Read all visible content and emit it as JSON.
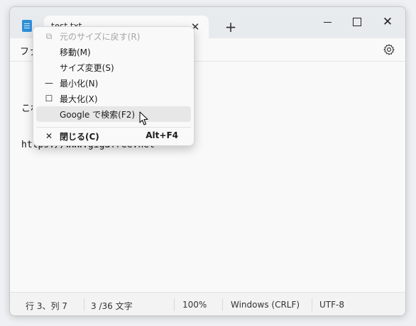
{
  "window": {
    "tab_title": "test.txt",
    "close_glyph": "✕",
    "new_tab_glyph": "+"
  },
  "menubar": {
    "file_label": "ファイル"
  },
  "editor": {
    "line1": "これは",
    "line2": "https://www.gigafree.net"
  },
  "context_menu": {
    "items": [
      {
        "icon": "restore-icon",
        "glyph": "⧉",
        "label": "元のサイズに戻す(R)",
        "shortcut": "",
        "disabled": true
      },
      {
        "icon": "",
        "glyph": "",
        "label": "移動(M)",
        "shortcut": "",
        "disabled": false
      },
      {
        "icon": "",
        "glyph": "",
        "label": "サイズ変更(S)",
        "shortcut": "",
        "disabled": false
      },
      {
        "icon": "minimize-icon",
        "glyph": "—",
        "label": "最小化(N)",
        "shortcut": "",
        "disabled": false
      },
      {
        "icon": "maximize-icon",
        "glyph": "☐",
        "label": "最大化(X)",
        "shortcut": "",
        "disabled": false
      },
      {
        "icon": "",
        "glyph": "",
        "label": "Google で検索(F2)",
        "shortcut": "",
        "disabled": false
      },
      {
        "icon": "close-icon",
        "glyph": "✕",
        "label": "閉じる(C)",
        "shortcut": "Alt+F4",
        "disabled": false
      }
    ]
  },
  "statusbar": {
    "position": "行 3、列 7",
    "chars": "3 /36 文字",
    "zoom": "100%",
    "line_ending": "Windows (CRLF)",
    "encoding": "UTF-8"
  }
}
